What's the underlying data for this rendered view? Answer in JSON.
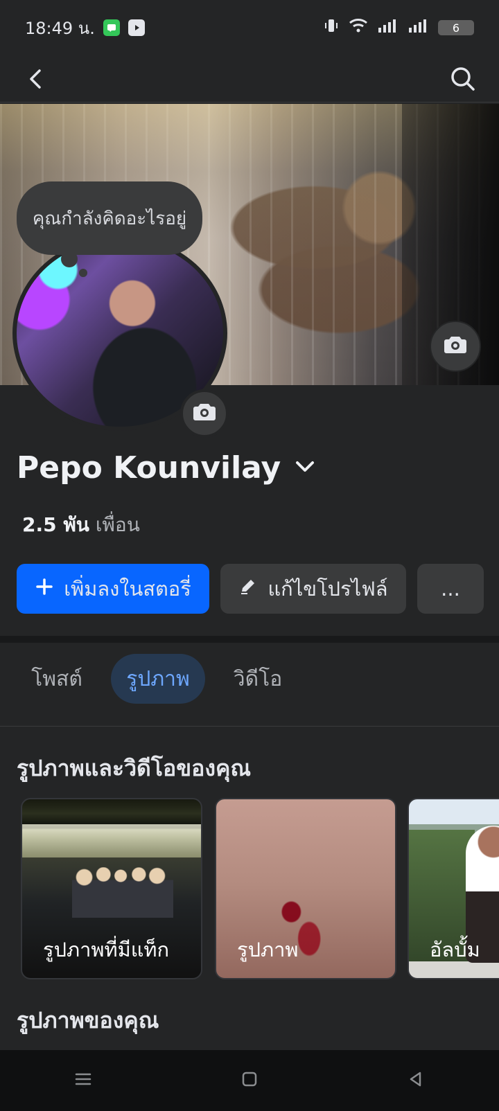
{
  "status_bar": {
    "time": "18:49 น.",
    "battery": "6"
  },
  "top_nav": {
    "back_icon": "back-icon",
    "search_icon": "search-icon"
  },
  "profile": {
    "thought_bubble": "คุณกำลังคิดอะไรอยู่",
    "name": "Pepo Kounvilay",
    "friends_count": "2.5 พัน",
    "friends_label": "เพื่อน"
  },
  "actions": {
    "add_story": "เพิ่มลงในสตอรี่",
    "edit_profile": "แก้ไขโปรไฟล์",
    "more": "..."
  },
  "tabs": [
    {
      "label": "โพสต์"
    },
    {
      "label": "รูปภาพ"
    },
    {
      "label": "วิดีโอ"
    }
  ],
  "sections": {
    "media_title": "รูปภาพและวิดีโอของคุณ",
    "photos_title": "รูปภาพของคุณ"
  },
  "media_cards": [
    {
      "label": "รูปภาพที่มีแท็ก"
    },
    {
      "label": "รูปภาพ"
    },
    {
      "label": "อัลบั้ม"
    }
  ],
  "colors": {
    "background": "#242526",
    "accent": "#0866ff",
    "active_tab": "#263951"
  }
}
